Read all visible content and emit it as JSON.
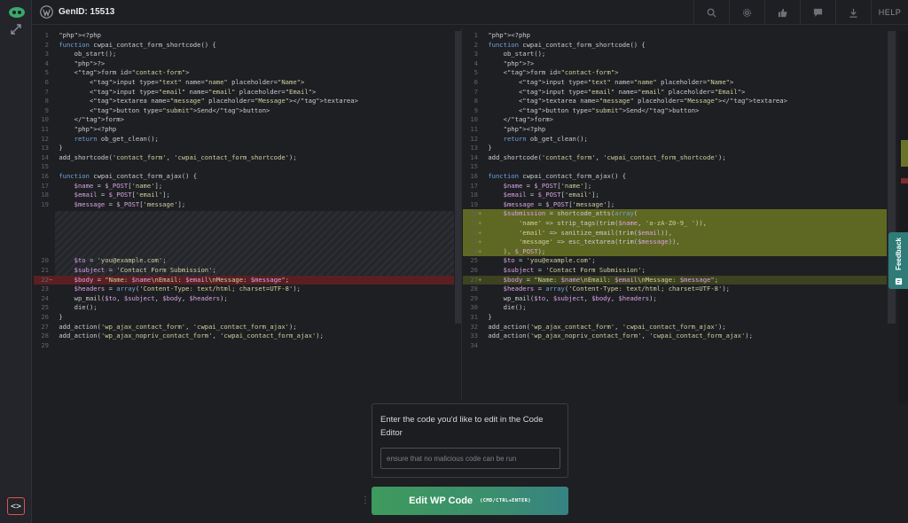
{
  "header": {
    "gen_id": "GenID: 15513",
    "help_label": "HELP"
  },
  "toolbar_icons": [
    "search-icon",
    "gear-icon",
    "thumbs-up-icon",
    "comment-icon",
    "download-icon"
  ],
  "left_editor": {
    "lines": [
      {
        "n": "1",
        "text": "<?php"
      },
      {
        "n": "2",
        "text": "function cwpai_contact_form_shortcode() {"
      },
      {
        "n": "3",
        "text": "    ob_start();"
      },
      {
        "n": "4",
        "text": "    ?>"
      },
      {
        "n": "5",
        "text": "    <form id=\"contact-form\">"
      },
      {
        "n": "6",
        "text": "        <input type=\"text\" name=\"name\" placeholder=\"Name\">"
      },
      {
        "n": "7",
        "text": "        <input type=\"email\" name=\"email\" placeholder=\"Email\">"
      },
      {
        "n": "8",
        "text": "        <textarea name=\"message\" placeholder=\"Message\"></textarea>"
      },
      {
        "n": "9",
        "text": "        <button type=\"submit\">Send</button>"
      },
      {
        "n": "10",
        "text": "    </form>"
      },
      {
        "n": "11",
        "text": "    <?php"
      },
      {
        "n": "12",
        "text": "    return ob_get_clean();"
      },
      {
        "n": "13",
        "text": "}"
      },
      {
        "n": "14",
        "text": "add_shortcode('contact_form', 'cwpai_contact_form_shortcode');"
      },
      {
        "n": "15",
        "text": ""
      },
      {
        "n": "16",
        "text": "function cwpai_contact_form_ajax() {"
      },
      {
        "n": "17",
        "text": "    $name = $_POST['name'];"
      },
      {
        "n": "18",
        "text": "    $email = $_POST['email'];"
      },
      {
        "n": "19",
        "text": "    $message = $_POST['message'];"
      },
      {
        "n": "20",
        "text": "    $to = 'you@example.com';"
      },
      {
        "n": "21",
        "text": "    $subject = 'Contact Form Submission';"
      },
      {
        "n": "22",
        "text": "    $body = \"Name: $name\\nEmail: $email\\nMessage: $message\";",
        "mark": "−",
        "state": "del"
      },
      {
        "n": "23",
        "text": "    $headers = array('Content-Type: text/html; charset=UTF-8');"
      },
      {
        "n": "24",
        "text": "    wp_mail($to, $subject, $body, $headers);"
      },
      {
        "n": "25",
        "text": "    die();"
      },
      {
        "n": "26",
        "text": "}"
      },
      {
        "n": "27",
        "text": "add_action('wp_ajax_contact_form', 'cwpai_contact_form_ajax');"
      },
      {
        "n": "28",
        "text": "add_action('wp_ajax_nopriv_contact_form', 'cwpai_contact_form_ajax');"
      },
      {
        "n": "29",
        "text": ""
      }
    ]
  },
  "right_editor": {
    "lines": [
      {
        "n": "1",
        "text": "<?php"
      },
      {
        "n": "2",
        "text": "function cwpai_contact_form_shortcode() {"
      },
      {
        "n": "3",
        "text": "    ob_start();"
      },
      {
        "n": "4",
        "text": "    ?>"
      },
      {
        "n": "5",
        "text": "    <form id=\"contact-form\">"
      },
      {
        "n": "6",
        "text": "        <input type=\"text\" name=\"name\" placeholder=\"Name\">"
      },
      {
        "n": "7",
        "text": "        <input type=\"email\" name=\"email\" placeholder=\"Email\">"
      },
      {
        "n": "8",
        "text": "        <textarea name=\"message\" placeholder=\"Message\"></textarea>"
      },
      {
        "n": "9",
        "text": "        <button type=\"submit\">Send</button>"
      },
      {
        "n": "10",
        "text": "    </form>"
      },
      {
        "n": "11",
        "text": "    <?php"
      },
      {
        "n": "12",
        "text": "    return ob_get_clean();"
      },
      {
        "n": "13",
        "text": "}"
      },
      {
        "n": "14",
        "text": "add_shortcode('contact_form', 'cwpai_contact_form_shortcode');"
      },
      {
        "n": "15",
        "text": ""
      },
      {
        "n": "16",
        "text": "function cwpai_contact_form_ajax() {"
      },
      {
        "n": "17",
        "text": "    $name = $_POST['name'];"
      },
      {
        "n": "18",
        "text": "    $email = $_POST['email'];"
      },
      {
        "n": "19",
        "text": "    $message = $_POST['message'];"
      },
      {
        "n": "20",
        "text": "    $submission = shortcode_atts(array(",
        "mark": "+",
        "state": "add"
      },
      {
        "n": "21",
        "text": "        'name' => strip_tags(trim($name, 'a-zA-Z0-9_ ')),",
        "mark": "+",
        "state": "add"
      },
      {
        "n": "22",
        "text": "        'email' => sanitize_email(trim($email)),",
        "mark": "+",
        "state": "add"
      },
      {
        "n": "23",
        "text": "        'message' => esc_textarea(trim($message)),",
        "mark": "+",
        "state": "add"
      },
      {
        "n": "24",
        "text": "    ), $_POST);",
        "mark": "+",
        "state": "add"
      },
      {
        "n": "25",
        "text": "    $to = 'you@example.com';"
      },
      {
        "n": "26",
        "text": "    $subject = 'Contact Form Submission';"
      },
      {
        "n": "27",
        "text": "    $body = \"Name: $name\\nEmail: $email\\nMessage: $message\";",
        "mark": "+",
        "state": "addlight"
      },
      {
        "n": "28",
        "text": "    $headers = array('Content-Type: text/html; charset=UTF-8');"
      },
      {
        "n": "29",
        "text": "    wp_mail($to, $subject, $body, $headers);"
      },
      {
        "n": "30",
        "text": "    die();"
      },
      {
        "n": "31",
        "text": "}"
      },
      {
        "n": "32",
        "text": "add_action('wp_ajax_contact_form', 'cwpai_contact_form_ajax');"
      },
      {
        "n": "33",
        "text": "add_action('wp_ajax_nopriv_contact_form', 'cwpai_contact_form_ajax');"
      },
      {
        "n": "34",
        "text": ""
      }
    ]
  },
  "feedback": {
    "label": "Feedback"
  },
  "prompt": {
    "label": "Enter the code you'd like to edit in the Code Editor",
    "placeholder": "ensure that no malicious code can be run",
    "value": ""
  },
  "edit_button": {
    "label": "Edit WP Code",
    "shortcut": "(CMD/CTRL+ENTER)"
  },
  "colors": {
    "accent": "#3e9a5d",
    "added": "#5f6822",
    "removed": "#5a1f22",
    "feedback": "#2e7b78"
  }
}
